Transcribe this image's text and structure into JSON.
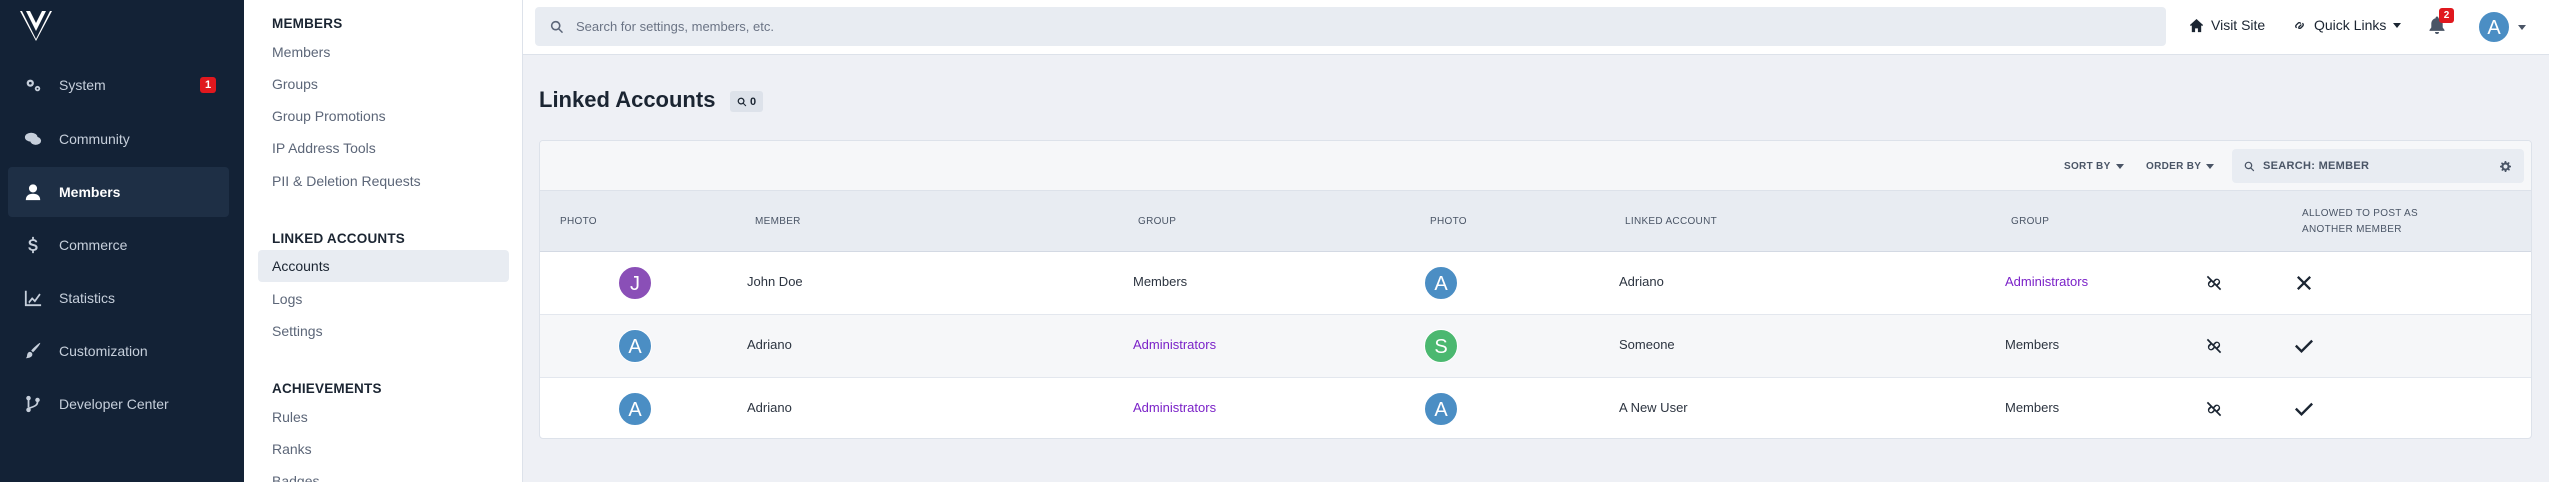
{
  "colors": {
    "nav_bg": "#132236",
    "accent_link": "#7b22c8",
    "badge": "#e0181e",
    "avatar_blue": "#4b8ec4",
    "avatar_purple": "#8a4fb7",
    "avatar_green": "#4bb870"
  },
  "nav": {
    "items": [
      {
        "label": "System",
        "icon": "gears-icon",
        "badge": "1"
      },
      {
        "label": "Community",
        "icon": "comments-icon"
      },
      {
        "label": "Members",
        "icon": "user-icon",
        "active": true
      },
      {
        "label": "Commerce",
        "icon": "dollar-icon"
      },
      {
        "label": "Statistics",
        "icon": "chart-line-icon"
      },
      {
        "label": "Customization",
        "icon": "paintbrush-icon"
      },
      {
        "label": "Developer Center",
        "icon": "code-branch-icon"
      }
    ]
  },
  "subnav": {
    "members_heading": "MEMBERS",
    "members_links": [
      "Members",
      "Groups",
      "Group Promotions",
      "IP Address Tools",
      "PII & Deletion Requests"
    ],
    "linked_heading": "LINKED ACCOUNTS",
    "linked_links": [
      "Accounts",
      "Logs",
      "Settings"
    ],
    "achievements_heading": "ACHIEVEMENTS",
    "achievements_links": [
      "Rules",
      "Ranks",
      "Badges"
    ]
  },
  "topbar": {
    "search_placeholder": "Search for settings, members, etc.",
    "visit_site": "Visit Site",
    "quick_links": "Quick Links",
    "notifications_count": "2",
    "user_initial": "A"
  },
  "main": {
    "title": "Linked Accounts",
    "count": "0",
    "sort_by": "SORT BY",
    "order_by": "ORDER BY",
    "search_placeholder": "SEARCH: MEMBER",
    "columns": [
      "PHOTO",
      "MEMBER",
      "GROUP",
      "PHOTO",
      "LINKED ACCOUNT",
      "GROUP",
      "ALLOWED TO POST AS",
      "ANOTHER MEMBER"
    ],
    "rows": [
      {
        "photo": "J",
        "photo_color": "#8a4fb7",
        "member": "John Doe",
        "group": "Members",
        "group_link": false,
        "linked_photo": "A",
        "linked_color": "#4b8ec4",
        "linked_account": "Adriano",
        "linked_group": "Administrators",
        "linked_group_link": true,
        "allowed": "no"
      },
      {
        "photo": "A",
        "photo_color": "#4b8ec4",
        "member": "Adriano",
        "group": "Administrators",
        "group_link": true,
        "linked_photo": "S",
        "linked_color": "#4bb870",
        "linked_account": "Someone",
        "linked_group": "Members",
        "linked_group_link": false,
        "allowed": "yes"
      },
      {
        "photo": "A",
        "photo_color": "#4b8ec4",
        "member": "Adriano",
        "group": "Administrators",
        "group_link": true,
        "linked_photo": "A",
        "linked_color": "#4b8ec4",
        "linked_account": "A New User",
        "linked_group": "Members",
        "linked_group_link": false,
        "allowed": "yes"
      }
    ]
  }
}
